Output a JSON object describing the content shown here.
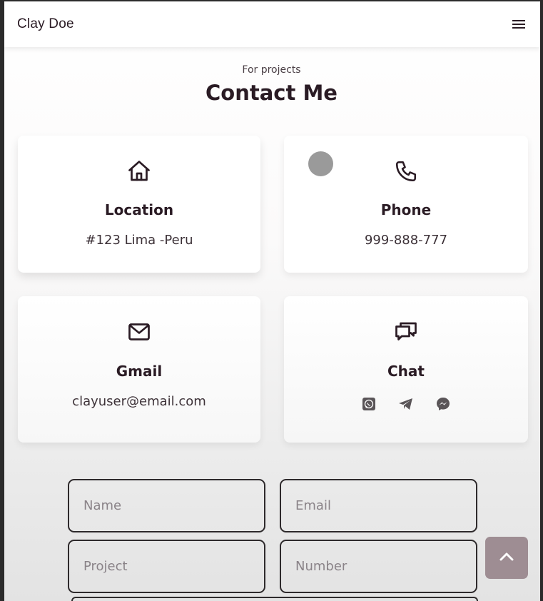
{
  "header": {
    "logo": "Clay Doe",
    "menu_icon": "hamburger-menu-icon"
  },
  "section": {
    "subtitle": "For projects",
    "title": "Contact Me"
  },
  "cards": [
    {
      "icon": "home-icon",
      "title": "Location",
      "value": "#123 Lima -Peru"
    },
    {
      "icon": "phone-icon",
      "title": "Phone",
      "value": "999-888-777"
    },
    {
      "icon": "mail-icon",
      "title": "Gmail",
      "value": "clayuser@email.com"
    },
    {
      "icon": "chat-icon",
      "title": "Chat",
      "links": [
        "whatsapp-icon",
        "telegram-icon",
        "messenger-icon"
      ]
    }
  ],
  "form": {
    "name_placeholder": "Name",
    "email_placeholder": "Email",
    "project_placeholder": "Project",
    "number_placeholder": "Number"
  },
  "scroll_up_icon": "chevron-up-icon",
  "colors": {
    "title": "#2a1b24",
    "scroll_button": "#9e8d93",
    "field_border": "#2e2a2c"
  }
}
